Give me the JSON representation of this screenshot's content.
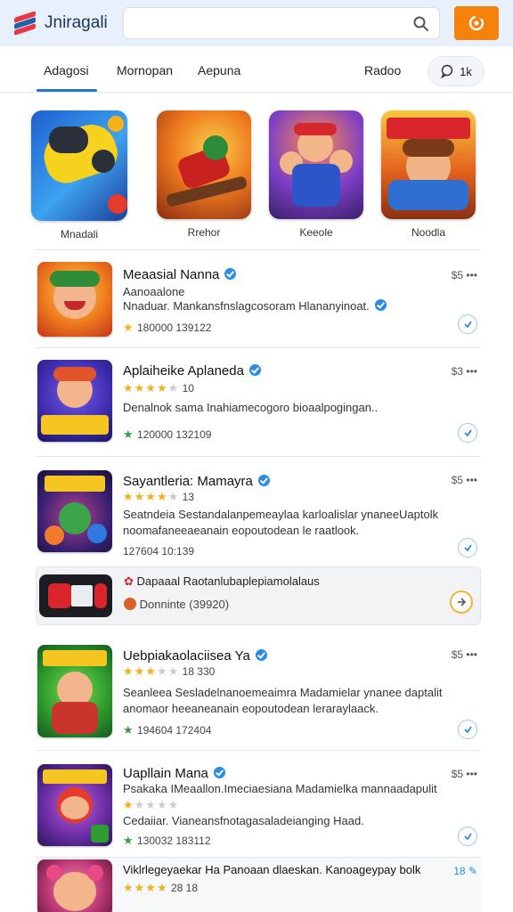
{
  "app": {
    "title": "Jniragali"
  },
  "search": {
    "placeholder": ""
  },
  "tabs": [
    {
      "label": "Adagosi"
    },
    {
      "label": "Mornopan"
    },
    {
      "label": "Aepuna"
    },
    {
      "label": "Radoo"
    }
  ],
  "chat_tab": {
    "label": "1k"
  },
  "featured": [
    {
      "label": "Mnadali"
    },
    {
      "label": "Rrehor"
    },
    {
      "label": "Keeole"
    },
    {
      "label": "Noodla"
    }
  ],
  "list": [
    {
      "title": "Meaasial Nanna",
      "subtitle": "Aanoaalone",
      "desc": "Nnaduar. Mankansfnslagcosoram Hlananyinoat.",
      "meta": "180000 139122",
      "price": "$5",
      "rating": 1
    },
    {
      "title": "Aplaiheike Aplaneda",
      "rating_label": "10",
      "desc": "Denalnok sama Inahiamecogoro bioaalpogingan..",
      "meta": "120000 132109",
      "price": "$3",
      "rating": 4
    },
    {
      "title": "Sayantleria: Mamayra",
      "rating_label": "13",
      "desc": "Seatndeia Sestandalanpemeaylaa karloalislar ynaneeUaptolk",
      "desc2": "noomafaneeaeanain eopoutodean le raatlook.",
      "meta": "127604 10:139",
      "price": "$5",
      "rating": 4
    },
    {
      "title": "Uebpiakaolaciisea Ya",
      "rating_label": "18 330",
      "desc": "Seanleea Sesladelnanoemeaimra Madamielar ynanee daptalit",
      "desc2": "anomaor heeaneanain eopoutodean leraraylaack.",
      "meta": "194604 172404",
      "price": "$5",
      "rating": 3
    },
    {
      "title": "Uapllain Mana",
      "subtitle": "Psakaka  IMeaallon.Imeciaesiana Madamielka mannaadapulit",
      "desc": "Cedaiiar. Vianeansfnotagasaladeianging Haad.",
      "meta": "130032 183112",
      "price": "$5",
      "rating": 1
    },
    {
      "title": "Viklrlegeyaekar Ha Panoaan dlaeskan. Kanoageypay bolk",
      "rating_label": "28 18",
      "price": "18",
      "rating": 4
    }
  ],
  "promo": {
    "title": "Dapaaal Raotanlubaplepiamolalaus",
    "subtitle": "Donninte (39920)"
  },
  "colors": {
    "header_bg": "#e8f1fb",
    "accent": "#1f78d1",
    "orange": "#f5820d",
    "star": "#f2b01e"
  }
}
